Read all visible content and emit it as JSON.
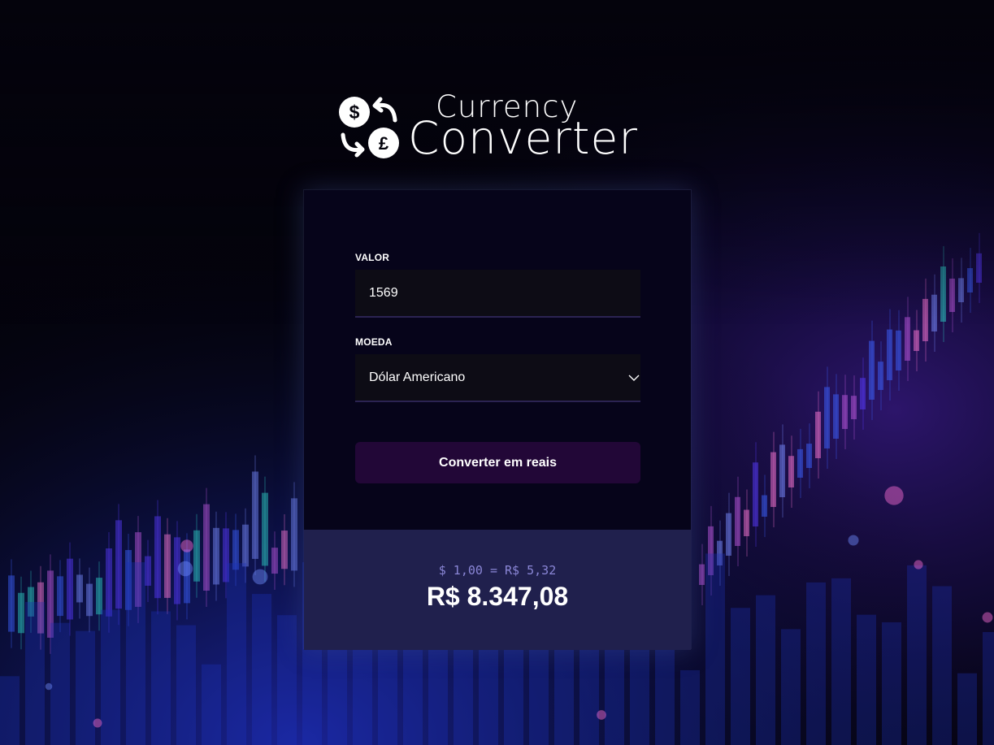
{
  "app": {
    "logo_line1": "Currency",
    "logo_line2": "Converter"
  },
  "form": {
    "amount_label": "VALOR",
    "amount_value": "1569",
    "currency_label": "MOEDA",
    "currency_selected": "Dólar Americano",
    "convert_button": "Converter em reais"
  },
  "result": {
    "rate_text": "$ 1,00 = R$ 5,32",
    "total_text": "R$ 8.347,08"
  },
  "colors": {
    "page_background": "#04030c",
    "card_background": "#06041a",
    "input_background": "#0d0c15",
    "button_background": "#220737",
    "result_background": "#20204d",
    "rate_text": "#8a86d6"
  },
  "icons": {
    "logo": "currency-exchange-icon",
    "select_arrow": "chevron-down-icon"
  }
}
